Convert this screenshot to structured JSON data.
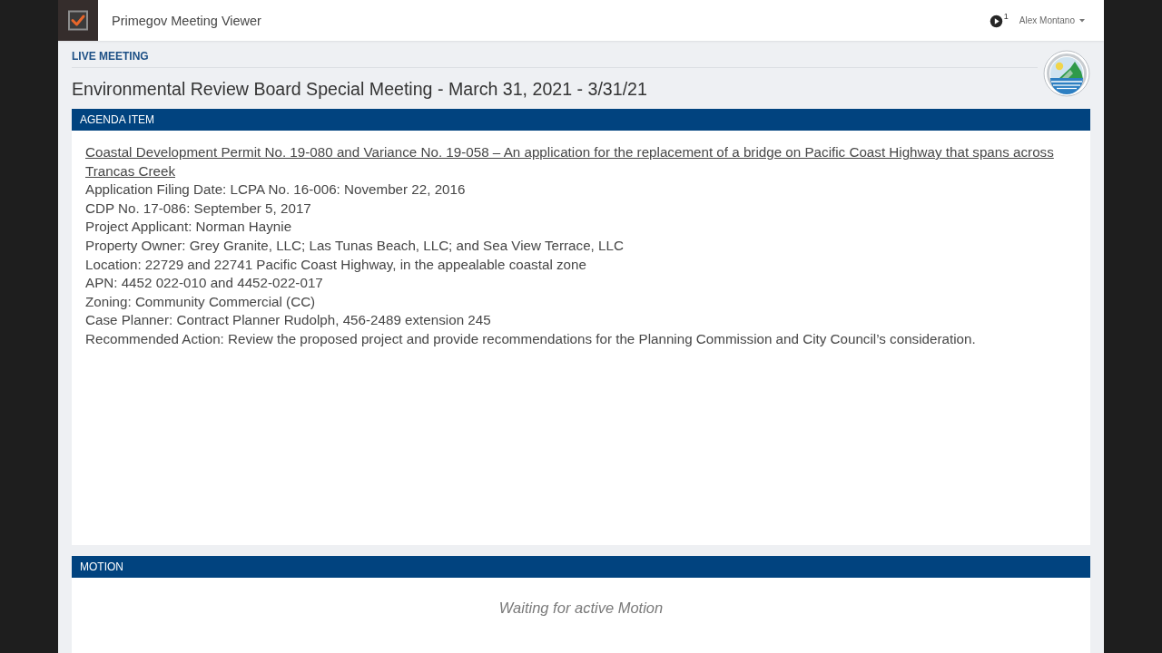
{
  "top_bar": {
    "app_title": "Primegov Meeting Viewer",
    "notification_count": "1",
    "user_name": "Alex Montano"
  },
  "meeting": {
    "status_label": "LIVE MEETING",
    "title": "Environmental Review Board Special Meeting - March 31, 2021 - 3/31/21"
  },
  "agenda_item": {
    "header": "AGENDA ITEM",
    "title": "Coastal Development Permit No. 19-080 and Variance No. 19-058 – An application for the replacement of a bridge on Pacific Coast Highway that spans across Trancas Creek",
    "details": [
      "Application Filing Date: LCPA No. 16-006: November 22, 2016",
      "CDP No. 17-086: September 5, 2017",
      "Project Applicant: Norman Haynie",
      "Property Owner: Grey Granite, LLC; Las Tunas Beach, LLC; and Sea View Terrace, LLC",
      "Location: 22729 and 22741 Pacific Coast Highway, in the appealable coastal zone",
      "APN: 4452 022-010 and 4452-022-017",
      "Zoning: Community Commercial (CC)",
      "Case Planner: Contract Planner Rudolph, 456-2489 extension 245",
      "Recommended Action: Review the proposed project and provide recommendations for the Planning Commission and City Council’s consideration."
    ]
  },
  "motion": {
    "header": "MOTION",
    "status": "Waiting for active Motion"
  }
}
